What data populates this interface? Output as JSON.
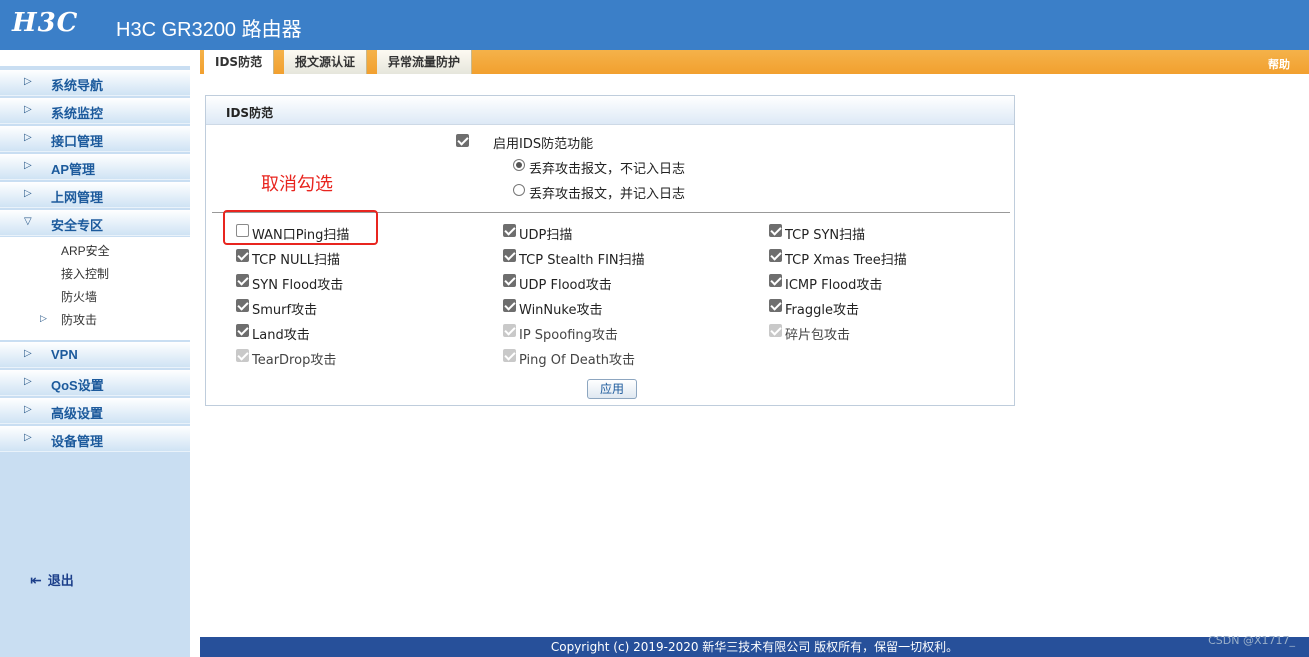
{
  "header": {
    "logo": "H3C",
    "title": "H3C GR3200 路由器"
  },
  "sidebar": {
    "items": [
      {
        "label": "系统导航"
      },
      {
        "label": "系统监控"
      },
      {
        "label": "接口管理"
      },
      {
        "label": "AP管理"
      },
      {
        "label": "上网管理"
      },
      {
        "label": "安全专区"
      },
      {
        "label": "VPN"
      },
      {
        "label": "QoS设置"
      },
      {
        "label": "高级设置"
      },
      {
        "label": "设备管理"
      }
    ],
    "submenu": [
      "ARP安全",
      "接入控制",
      "防火墙",
      "防攻击"
    ],
    "logout": "退出"
  },
  "tabs": [
    {
      "label": "IDS防范",
      "active": true
    },
    {
      "label": "报文源认证",
      "active": false
    },
    {
      "label": "异常流量防护",
      "active": false
    }
  ],
  "help": "帮助",
  "panel": {
    "title": "IDS防范",
    "enable_label": "启用IDS防范功能",
    "enable_checked": true,
    "radio_options": [
      {
        "label": "丢弃攻击报文，不记入日志",
        "selected": true
      },
      {
        "label": "丢弃攻击报文，并记入日志",
        "selected": false
      }
    ],
    "annotation": "取消勾选",
    "checks": [
      {
        "label": "WAN口Ping扫描",
        "state": "unchecked"
      },
      {
        "label": "UDP扫描",
        "state": "checked"
      },
      {
        "label": "TCP SYN扫描",
        "state": "checked"
      },
      {
        "label": "TCP NULL扫描",
        "state": "checked"
      },
      {
        "label": "TCP Stealth FIN扫描",
        "state": "checked"
      },
      {
        "label": "TCP Xmas Tree扫描",
        "state": "checked"
      },
      {
        "label": "SYN Flood攻击",
        "state": "checked"
      },
      {
        "label": "UDP Flood攻击",
        "state": "checked"
      },
      {
        "label": "ICMP Flood攻击",
        "state": "checked"
      },
      {
        "label": "Smurf攻击",
        "state": "checked"
      },
      {
        "label": "WinNuke攻击",
        "state": "checked"
      },
      {
        "label": "Fraggle攻击",
        "state": "checked"
      },
      {
        "label": "Land攻击",
        "state": "checked"
      },
      {
        "label": "IP Spoofing攻击",
        "state": "disabled"
      },
      {
        "label": "碎片包攻击",
        "state": "disabled"
      },
      {
        "label": "TearDrop攻击",
        "state": "disabled"
      },
      {
        "label": "Ping Of Death攻击",
        "state": "disabled"
      }
    ],
    "apply_label": "应用"
  },
  "footer": "Copyright (c) 2019-2020 新华三技术有限公司 版权所有，保留一切权利。",
  "watermark": "CSDN @X1717_"
}
